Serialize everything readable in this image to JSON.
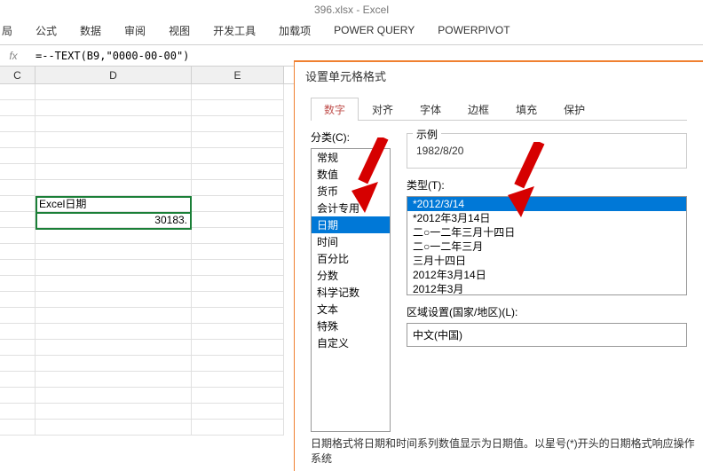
{
  "app": {
    "title": "396.xlsx - Excel"
  },
  "ribbon": {
    "tabs": [
      "局",
      "公式",
      "数据",
      "审阅",
      "视图",
      "开发工具",
      "加载项",
      "POWER QUERY",
      "POWERPIVOT"
    ]
  },
  "formula_bar": {
    "fx": "fx",
    "value": "=--TEXT(B9,\"0000-00-00\")"
  },
  "columns": {
    "c": "C",
    "d": "D",
    "e": "E"
  },
  "cells": {
    "d_label": "Excel日期",
    "d_value": "30183."
  },
  "dialog": {
    "title": "设置单元格格式",
    "tabs": [
      "数字",
      "对齐",
      "字体",
      "边框",
      "填充",
      "保护"
    ],
    "category_label": "分类(C):",
    "categories": [
      "常规",
      "数值",
      "货币",
      "会计专用",
      "日期",
      "时间",
      "百分比",
      "分数",
      "科学记数",
      "文本",
      "特殊",
      "自定义"
    ],
    "selected_category_index": 4,
    "sample_legend": "示例",
    "sample_value": "1982/8/20",
    "type_label": "类型(T):",
    "types": [
      "*2012/3/14",
      "*2012年3月14日",
      "二○一二年三月十四日",
      "二○一二年三月",
      "三月十四日",
      "2012年3月14日",
      "2012年3月"
    ],
    "selected_type_index": 0,
    "locale_label": "区域设置(国家/地区)(L):",
    "locale_value": "中文(中国)",
    "footer": "日期格式将日期和时间系列数值显示为日期值。以星号(*)开头的日期格式响应操作系统"
  }
}
